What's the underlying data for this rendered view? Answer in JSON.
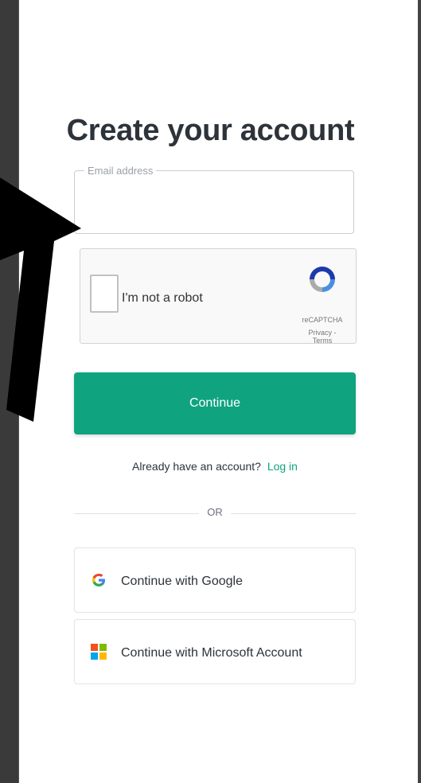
{
  "page": {
    "title": "Create your account"
  },
  "email": {
    "label": "Email address",
    "value": "",
    "placeholder": ""
  },
  "captcha": {
    "label": "I'm not a robot",
    "brand": "reCAPTCHA",
    "links": "Privacy - Terms"
  },
  "actions": {
    "continue_label": "Continue",
    "login_prompt": "Already have an account?",
    "login_link": "Log in",
    "or_label": "OR"
  },
  "social": {
    "google_label": "Continue with Google",
    "microsoft_label": "Continue with Microsoft Account"
  },
  "colors": {
    "accent": "#10a37f",
    "background": "#3a3a3a",
    "card": "#ffffff",
    "annotation_arrow": "#000000"
  },
  "icons": {
    "google": "google-icon",
    "microsoft": "microsoft-icon",
    "recaptcha": "recaptcha-icon",
    "arrow": "arrow-annotation"
  }
}
